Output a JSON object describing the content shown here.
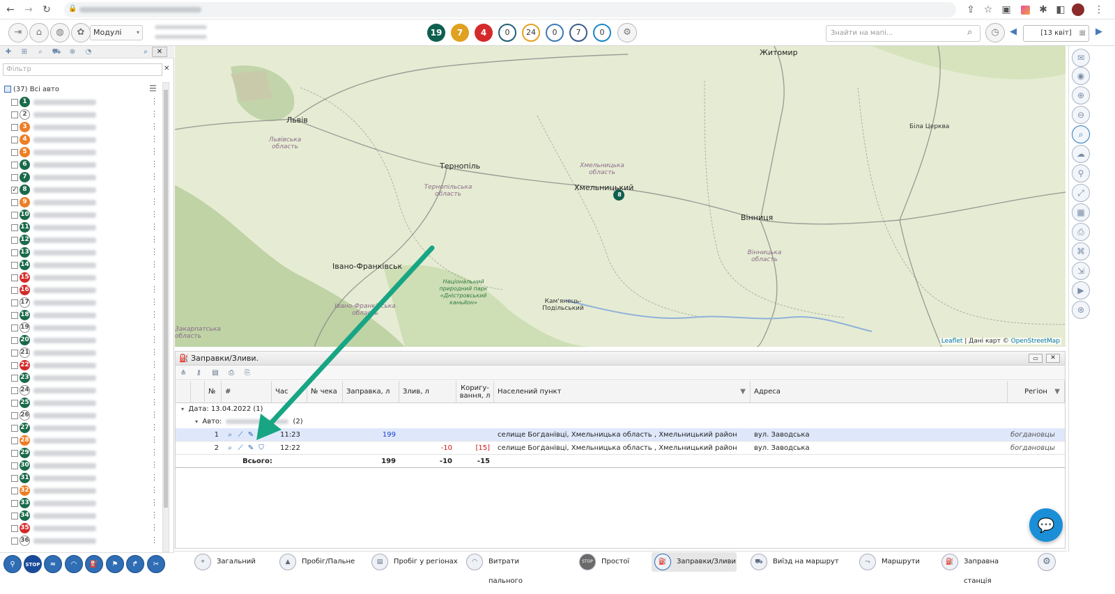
{
  "toolbar": {
    "modules_label": "Модулі",
    "counters": [
      {
        "value": "19",
        "color": "#0f5f4f"
      },
      {
        "value": "7",
        "color": "#e0a020"
      },
      {
        "value": "4",
        "color": "#d42a2a"
      },
      {
        "value": "0",
        "color": "#ffffff"
      },
      {
        "value": "24",
        "color": "#ffffff"
      },
      {
        "value": "0",
        "color": "#ffffff"
      },
      {
        "value": "7",
        "color": "#ffffff"
      },
      {
        "value": "0",
        "color": "#ffffff"
      }
    ],
    "search_placeholder": "Знайти на мапі...",
    "date": "[13 квіт]"
  },
  "sidebar": {
    "filter_placeholder": "Фільтр",
    "all_cars": "(37) Всі авто",
    "vehicles": [
      {
        "n": "1",
        "c": "#1a6a4a",
        "checked": false
      },
      {
        "n": "2",
        "c": "outline",
        "checked": false
      },
      {
        "n": "3",
        "c": "#ee7d24",
        "checked": false
      },
      {
        "n": "4",
        "c": "#ee7d24",
        "checked": false
      },
      {
        "n": "5",
        "c": "#ee7d24",
        "checked": false
      },
      {
        "n": "6",
        "c": "#1a6a4a",
        "checked": false
      },
      {
        "n": "7",
        "c": "#1a6a4a",
        "checked": false
      },
      {
        "n": "8",
        "c": "#1a6a4a",
        "checked": true
      },
      {
        "n": "9",
        "c": "#ee7d24",
        "checked": false
      },
      {
        "n": "10",
        "c": "#1a6a4a",
        "checked": false
      },
      {
        "n": "11",
        "c": "#1a6a4a",
        "checked": false
      },
      {
        "n": "12",
        "c": "#1a6a4a",
        "checked": false
      },
      {
        "n": "13",
        "c": "#1a6a4a",
        "checked": false
      },
      {
        "n": "14",
        "c": "#1a6a4a",
        "checked": false
      },
      {
        "n": "15",
        "c": "#d42a2a",
        "checked": false
      },
      {
        "n": "16",
        "c": "#d42a2a",
        "checked": false
      },
      {
        "n": "17",
        "c": "outline",
        "checked": false
      },
      {
        "n": "18",
        "c": "#1a6a4a",
        "checked": false
      },
      {
        "n": "19",
        "c": "outline",
        "checked": false
      },
      {
        "n": "20",
        "c": "#1a6a4a",
        "checked": false
      },
      {
        "n": "21",
        "c": "outline",
        "checked": false
      },
      {
        "n": "22",
        "c": "#d42a2a",
        "checked": false
      },
      {
        "n": "23",
        "c": "#1a6a4a",
        "checked": false
      },
      {
        "n": "24",
        "c": "outline",
        "checked": false
      },
      {
        "n": "25",
        "c": "#1a6a4a",
        "checked": false
      },
      {
        "n": "26",
        "c": "outline",
        "checked": false
      },
      {
        "n": "27",
        "c": "#1a6a4a",
        "checked": false
      },
      {
        "n": "28",
        "c": "#ee7d24",
        "checked": false
      },
      {
        "n": "29",
        "c": "#1a6a4a",
        "checked": false
      },
      {
        "n": "30",
        "c": "#1a6a4a",
        "checked": false
      },
      {
        "n": "31",
        "c": "#1a6a4a",
        "checked": false
      },
      {
        "n": "32",
        "c": "#ee7d24",
        "checked": false
      },
      {
        "n": "33",
        "c": "#1a6a4a",
        "checked": false
      },
      {
        "n": "34",
        "c": "#1a6a4a",
        "checked": false
      },
      {
        "n": "35",
        "c": "#d42a2a",
        "checked": false
      },
      {
        "n": "36",
        "c": "outline",
        "checked": false
      }
    ],
    "bottom_stop": "STOP"
  },
  "map": {
    "cities": {
      "zhytomyr": "Житомир",
      "lviv": "Львів",
      "lviv_obl": "Львівська область",
      "ternopil": "Тернопіль",
      "ternopil_obl": "Тернопільська область",
      "khmelnytskyi": "Хмельницький",
      "khm_obl": "Хмельницька область",
      "vinnytsia": "Вінниця",
      "vinn_obl": "Вінницька область",
      "bila": "Біла Церква",
      "if": "Івано-Франківськ",
      "if_obl": "Івано-Франківська область",
      "kp": "Кам'янець-Подільський",
      "park": "Національний природний парк «Дністровський каньйон»",
      "karp": "Закарпатська область"
    },
    "marker": "8",
    "attribution_leaflet": "Leaflet",
    "attribution_mid": " | Дані карт © ",
    "attribution_osm": "OpenStreetMap"
  },
  "panel": {
    "title": "Заправки/Зливи.",
    "columns": {
      "no": "№",
      "hash": "#",
      "time": "Час",
      "check": "№ чека",
      "refuel": "Заправка, л",
      "drain": "Злив, л",
      "corr_1": "Коригу-",
      "corr_2": "вання, л",
      "place": "Населений пункт",
      "address": "Адреса",
      "region": "Регіон"
    },
    "group_date": "Дата: 13.04.2022 (1)",
    "group_auto": "Авто:",
    "group_auto_count": "(2)",
    "rows": [
      {
        "no": "1",
        "time": "11:23",
        "check": "",
        "refuel": "199",
        "drain": "",
        "corr": "",
        "place": "селище Богданівці, Хмельницька область , Хмельницький район",
        "address": "вул. Заводська",
        "region": "богдановцы"
      },
      {
        "no": "2",
        "time": "12:22",
        "check": "",
        "refuel": "",
        "drain": "-10",
        "corr": "[15]",
        "place": "селище Богданівці, Хмельницька область , Хмельницький район",
        "address": "вул. Заводська",
        "region": "богдановцы"
      }
    ],
    "total_label": "Всього:",
    "total_refuel": "199",
    "total_drain": "-10",
    "total_corr": "-15"
  },
  "tabs": [
    {
      "label": "Загальний",
      "icon": "general-icon",
      "active": false
    },
    {
      "label": "Пробіг/Пальне",
      "icon": "road-icon",
      "active": false
    },
    {
      "label": "Пробіг у регіонах",
      "icon": "region-icon",
      "active": false
    },
    {
      "label": "Витрати пального",
      "icon": "gauge-icon",
      "active": false
    },
    {
      "label": "Простої",
      "icon": "stop-icon",
      "active": false
    },
    {
      "label": "Заправки/Зливи",
      "icon": "fuel-icon",
      "active": true
    },
    {
      "label": "Виїзд на маршрут",
      "icon": "car-icon",
      "active": false
    },
    {
      "label": "Маршрути",
      "icon": "route-icon",
      "active": false
    },
    {
      "label": "Заправна станція",
      "icon": "station-icon",
      "active": false
    }
  ],
  "tab_stop_text": "STOP",
  "arrow_color": "#17a584"
}
